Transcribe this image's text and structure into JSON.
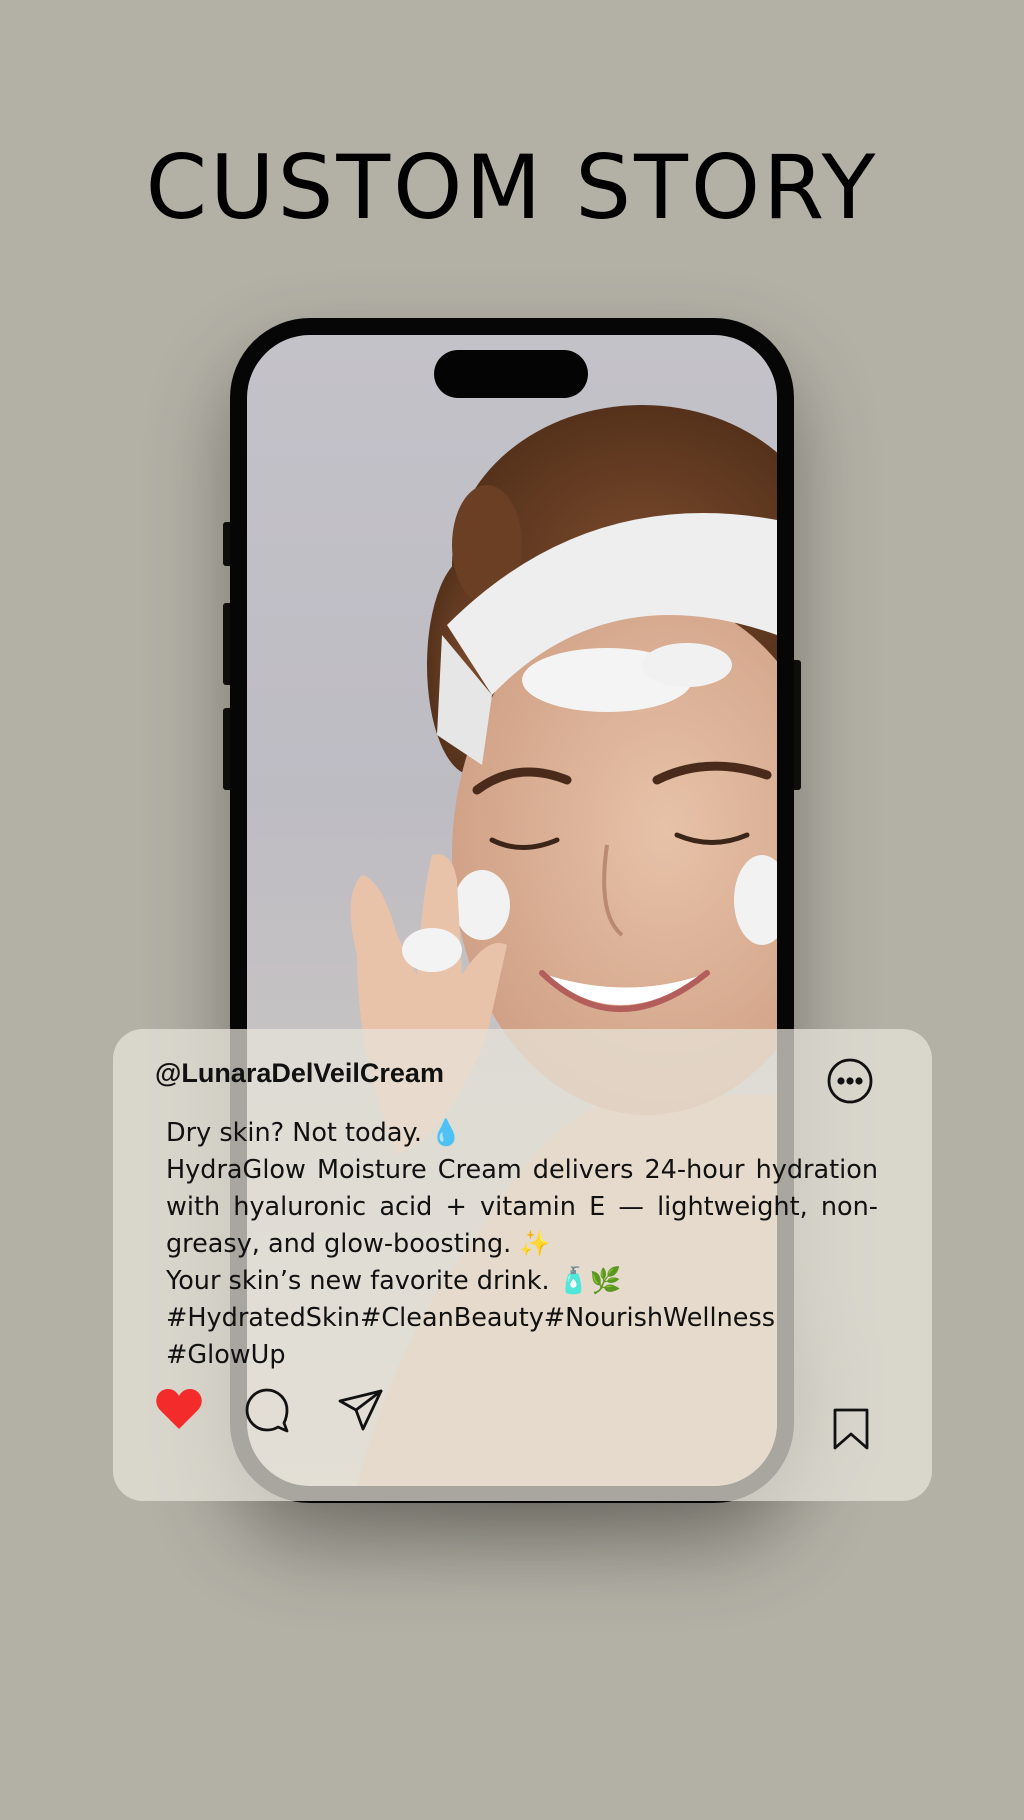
{
  "title": "CUSTOM STORY",
  "post": {
    "username": "@LunaraDelVeilCream",
    "caption": {
      "line1": "Dry skin? Not today. 💧",
      "line2": "HydraGlow Moisture Cream delivers 24-hour hydration with hyaluronic acid + vitamin E — lightweight, non-greasy, and glow-boosting. ✨",
      "line3": "Your skin’s new favorite drink. 🧴🌿",
      "line4": "#HydratedSkin#CleanBeauty#NourishWellness",
      "line5": "#GlowUp"
    },
    "liked": true
  },
  "icons": {
    "more": "more-options-icon",
    "like": "heart-icon",
    "comment": "comment-icon",
    "share": "send-icon",
    "save": "bookmark-icon"
  },
  "colors": {
    "background": "#b3b0a6",
    "like": "#f42b2b",
    "phone": "#060606"
  }
}
